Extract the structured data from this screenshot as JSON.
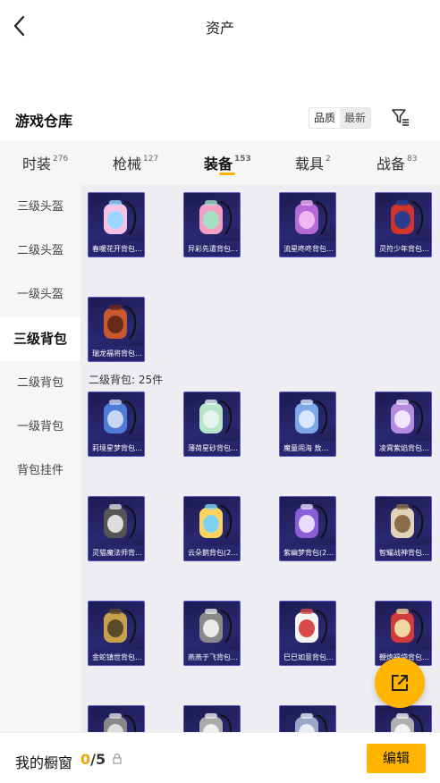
{
  "header": {
    "title": "资产"
  },
  "warehouse": {
    "title": "游戏仓库",
    "sort_quality": "品质",
    "sort_latest": "最新"
  },
  "tabs": [
    {
      "label": "时装",
      "count": "276"
    },
    {
      "label": "枪械",
      "count": "127"
    },
    {
      "label": "装备",
      "count": "153"
    },
    {
      "label": "载具",
      "count": "2"
    },
    {
      "label": "战备",
      "count": "83"
    }
  ],
  "sidebar": {
    "items": [
      {
        "label": "三级头盔"
      },
      {
        "label": "二级头盔"
      },
      {
        "label": "一级头盔"
      },
      {
        "label": "三级背包"
      },
      {
        "label": "二级背包"
      },
      {
        "label": "一级背包"
      },
      {
        "label": "背包挂件"
      }
    ]
  },
  "sections": [
    {
      "label": "",
      "items": [
        {
          "name": "春暖花开背包…",
          "colors": [
            "#f7c3e3",
            "#9ad8ff"
          ]
        },
        {
          "name": "异彩先遣背包…",
          "colors": [
            "#f2a1c4",
            "#a6e1c6"
          ]
        },
        {
          "name": "流星咚咚背包…",
          "colors": [
            "#b56bd6",
            "#f0b6f2"
          ]
        },
        {
          "name": "灵符少年背包…",
          "colors": [
            "#d0342c",
            "#2c3d8c"
          ]
        },
        {
          "name": "瑞龙福将背包…",
          "colors": [
            "#c9582e",
            "#6a2a1a"
          ]
        }
      ]
    },
    {
      "label": "二级背包: 25件",
      "items": [
        {
          "name": "莉境星梦背包…",
          "colors": [
            "#4d7bd6",
            "#c9d6f5"
          ]
        },
        {
          "name": "薄荷星砂背包…",
          "colors": [
            "#b7e6c9",
            "#e6f5ee"
          ]
        },
        {
          "name": "魔童闹海 敖…",
          "colors": [
            "#7fa8e8",
            "#d7e7ff"
          ]
        },
        {
          "name": "凌霄紫焰背包…",
          "colors": [
            "#b48bde",
            "#f1e6ff"
          ]
        },
        {
          "name": "灵猫魔法师背…",
          "colors": [
            "#555555",
            "#dddddd"
          ]
        },
        {
          "name": "云朵鹅背包(2…",
          "colors": [
            "#ffd35c",
            "#7fd1f0"
          ]
        },
        {
          "name": "紫幽梦背包(2…",
          "colors": [
            "#8a5fd6",
            "#e6dcff"
          ]
        },
        {
          "name": "智耀战神背包…",
          "colors": [
            "#e2d2b8",
            "#8c6d4b"
          ]
        },
        {
          "name": "金蛇镇世背包…",
          "colors": [
            "#c9a04b",
            "#5a4a2a"
          ]
        },
        {
          "name": "燕燕于飞背包…",
          "colors": [
            "#8a8a8a",
            "#eaeaea"
          ]
        },
        {
          "name": "巳巳如意背包…",
          "colors": [
            "#f4f4f4",
            "#d84a4a"
          ]
        },
        {
          "name": "鞭炮福袋背包…",
          "colors": [
            "#d13b3b",
            "#f2d7a0"
          ]
        },
        {
          "name": "",
          "colors": [
            "#888888",
            "#dddddd"
          ]
        },
        {
          "name": "",
          "colors": [
            "#aaaaaa",
            "#eeeeee"
          ]
        },
        {
          "name": "",
          "colors": [
            "#99a7c9",
            "#e8ecf7"
          ]
        },
        {
          "name": "",
          "colors": [
            "#b0b0b0",
            "#f4f4f4"
          ]
        }
      ]
    }
  ],
  "bottom": {
    "title": "我的橱窗",
    "count_current": "0",
    "count_total": "/5",
    "edit_label": "编辑"
  },
  "colors": {
    "accent": "#ffb400",
    "card_bg": "#23216a",
    "card_border": "#5c58c9"
  },
  "icons": {
    "back": "chevron-left-icon",
    "filter": "filter-icon",
    "share": "share-external-icon",
    "lock": "lock-icon"
  }
}
